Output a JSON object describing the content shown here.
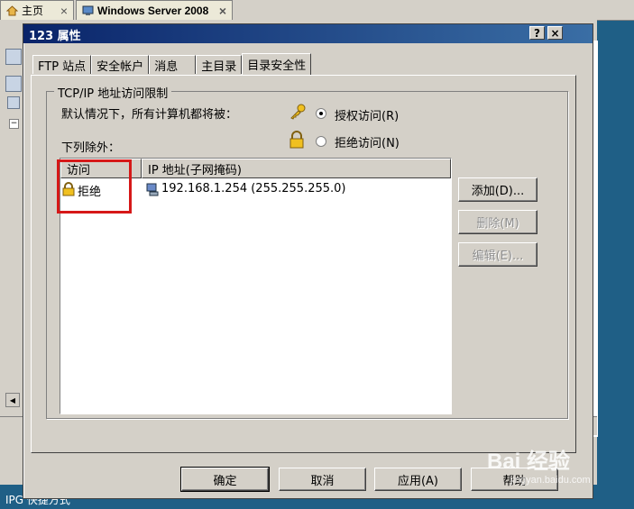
{
  "browser": {
    "tabs": [
      {
        "label": "主页",
        "icon": "home-icon"
      },
      {
        "label": "Windows Server 2008",
        "icon": "vm-icon"
      }
    ]
  },
  "dialog": {
    "title": "123 属性",
    "title_buttons": {
      "help": "?",
      "close": "×"
    },
    "tabs": [
      {
        "label": "FTP 站点",
        "active": false
      },
      {
        "label": "安全帐户",
        "active": false
      },
      {
        "label": "消息",
        "active": false
      },
      {
        "label": "主目录",
        "active": false
      },
      {
        "label": "目录安全性",
        "active": true
      }
    ],
    "group": {
      "title": "TCP/IP 地址访问限制",
      "default_text": "默认情况下，所有计算机都将被：",
      "options": [
        {
          "label": "授权访问(R)",
          "selected": true,
          "icon": "key-icon"
        },
        {
          "label": "拒绝访问(N)",
          "selected": false,
          "icon": "lock-icon"
        }
      ],
      "except_label": "下列除外：",
      "list": {
        "columns": [
          "访问",
          "IP 地址(子网掩码)"
        ],
        "rows": [
          {
            "access": "拒绝",
            "ip": "192.168.1.254 (255.255.255.0)"
          }
        ]
      },
      "buttons": {
        "add": "添加(D)...",
        "remove": "删除(M)",
        "edit": "编辑(E)..."
      }
    },
    "footer": {
      "ok": "确定",
      "cancel": "取消",
      "apply": "应用(A)",
      "help": "帮助"
    }
  },
  "status": {
    "text": "IPG  快捷方式"
  },
  "watermark": {
    "main": "Bai 经验",
    "sub": "jingyan.baidu.com"
  },
  "colors": {
    "title_bar": "#0a246a",
    "highlight": "#d61818",
    "desktop": "#1f5f86"
  }
}
